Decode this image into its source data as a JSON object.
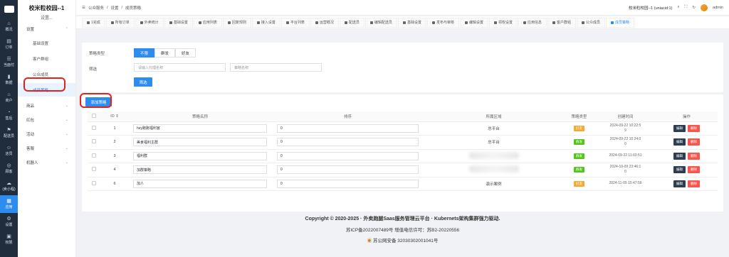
{
  "rail": [
    {
      "icon": "⌂",
      "label": "概况",
      "name": "rail-overview"
    },
    {
      "icon": "▤",
      "label": "订单",
      "name": "rail-orders"
    },
    {
      "icon": "☰",
      "label": "当面付",
      "name": "rail-facepay"
    },
    {
      "icon": "▮",
      "label": "数据",
      "name": "rail-data"
    },
    {
      "icon": "⌂",
      "label": "商户",
      "name": "rail-merchant"
    },
    {
      "icon": "◔",
      "label": "售后",
      "name": "rail-aftersale"
    },
    {
      "icon": "⚑",
      "label": "配送员",
      "name": "rail-rider"
    },
    {
      "icon": "☺",
      "label": "店员",
      "name": "rail-staff"
    },
    {
      "icon": "◎",
      "label": "顾客",
      "name": "rail-customer"
    },
    {
      "icon": "☁",
      "label": "(卖小程)",
      "name": "rail-miniapp"
    },
    {
      "icon": "▦",
      "label": "应用",
      "name": "rail-apps"
    },
    {
      "icon": "⚙",
      "label": "设置",
      "name": "rail-settings"
    },
    {
      "icon": "▣",
      "label": "权限",
      "name": "rail-permission"
    }
  ],
  "menu": {
    "brand": "校米粒校园--1",
    "brand_sub": "设置...",
    "groups": [
      {
        "label": "设置",
        "chev": "⌃"
      },
      {
        "label": "商品",
        "chev": "⌄"
      },
      {
        "label": "红包",
        "chev": "⌄"
      },
      {
        "label": "活动",
        "chev": "⌄"
      },
      {
        "label": "客服",
        "chev": "⌄"
      },
      {
        "label": "机器人",
        "chev": "⌄"
      }
    ],
    "subs": [
      "基础设置",
      "客户群组",
      "公众成员",
      "成员策略"
    ]
  },
  "header": {
    "breadcrumb": [
      "☰",
      "公众服务",
      "/",
      "设置",
      "/",
      "成员策略"
    ],
    "site_name": "校米粒校园--1 (uniacid:1)",
    "user": "admin"
  },
  "tabs": [
    "1完成",
    "所有订单",
    "外卖统计",
    "基础设置",
    "应用列表",
    "回复规则",
    "接入设置",
    "平台列表",
    "运营概况",
    "配送员",
    "编辑配送员",
    "基础设置",
    "发布与审核",
    "编辑设置",
    "领权设置",
    "应用信息",
    "客户群组",
    "公众成员",
    "成员策略"
  ],
  "filter": {
    "type_label": "策略类型",
    "segments": [
      "不限",
      "群发",
      "好友"
    ],
    "screen_label": "筛选",
    "agent_placeholder": "请输入代理名称",
    "name_placeholder": "策略名称",
    "search_btn": "筛选"
  },
  "add_btn": "添加策略",
  "table": {
    "headers": [
      "ID ⇕",
      "策略名称",
      "排序",
      "所属区域",
      "策略类型",
      "创建时间",
      "操作"
    ],
    "rows": [
      {
        "id": "1",
        "name": "hey跑跑福利官",
        "sort": "0",
        "area": "总平台",
        "type": "好友",
        "type_color": "orange",
        "time1": "2024-09-22 10:22:5",
        "time2": "9"
      },
      {
        "id": "2",
        "name": "美食福利主群",
        "sort": "0",
        "area": "总平台",
        "type": "群发",
        "type_color": "green",
        "time1": "2024-09-22 10:24:0",
        "time2": "0"
      },
      {
        "id": "3",
        "name": "福利群",
        "sort": "0",
        "area": "",
        "type": "群发",
        "type_color": "green",
        "time1": "2024-09-22 11:03:51",
        "time2": ""
      },
      {
        "id": "4",
        "name": "加群策略",
        "sort": "0",
        "area": "",
        "type": "群发",
        "type_color": "green",
        "time1": "2024-10-09 23:46:1",
        "time2": "0"
      },
      {
        "id": "6",
        "name": "加人",
        "sort": "0",
        "area": "演示案例",
        "type": "好友",
        "type_color": "orange",
        "time1": "2024-11-05 15:47:56",
        "time2": ""
      }
    ],
    "edit": "编辑",
    "delete": "删除"
  },
  "footer": {
    "line1": "Copyright © 2020-2025 · 外卖跑腿Saas服务管理云平台 · Kubernets架构集群强力驱动.",
    "line2": "苏ICP备2022007489号    增值电信许可：苏B2-20220556",
    "line3": "苏公网安备 32030302001041号"
  }
}
